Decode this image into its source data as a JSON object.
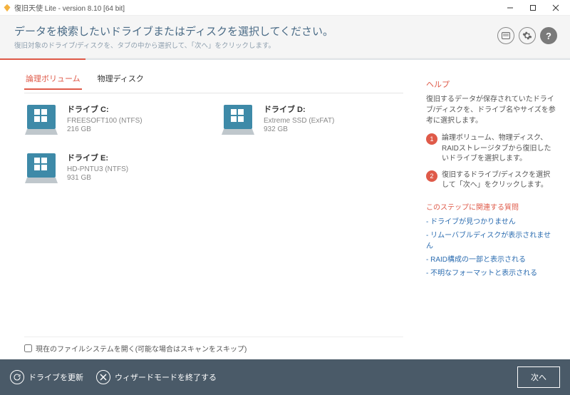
{
  "window": {
    "title": "復旧天使 Lite - version 8.10 [64 bit]"
  },
  "header": {
    "title": "データを検索したいドライブまたはディスクを選択してください。",
    "subtitle": "復旧対象のドライブ/ディスクを、タブの中から選択して、「次へ」をクリックします。"
  },
  "tabs": {
    "logical": "論理ボリューム",
    "physical": "物理ディスク"
  },
  "drives": [
    {
      "name": "ドライブ C:",
      "fs": "FREESOFT100 (NTFS)",
      "size": "216 GB"
    },
    {
      "name": "ドライブ D:",
      "fs": "Extreme SSD (ExFAT)",
      "size": "932 GB"
    },
    {
      "name": "ドライブ E:",
      "fs": "HD-PNTU3 (NTFS)",
      "size": "931 GB"
    }
  ],
  "skip": {
    "label": "現在のファイルシステムを開く(可能な場合はスキャンをスキップ)"
  },
  "help": {
    "title": "ヘルプ",
    "intro": "復旧するデータが保存されていたドライブ/ディスクを、ドライブ名やサイズを参考に選択します。",
    "steps": [
      "論理ボリューム、物理ディスク、RAIDストレージタブから復旧したいドライブを選択します。",
      "復旧するドライブ/ディスクを選択して「次へ」をクリックします。"
    ],
    "related_title": "このステップに関連する質問",
    "faq": [
      "- ドライブが見つかりません",
      "- リムーバブルディスクが表示されません",
      "- RAID構成の一部と表示される",
      "- 不明なフォーマットと表示される"
    ]
  },
  "footer": {
    "refresh": "ドライブを更新",
    "exit_wizard": "ウィザードモードを終了する",
    "next": "次へ"
  }
}
